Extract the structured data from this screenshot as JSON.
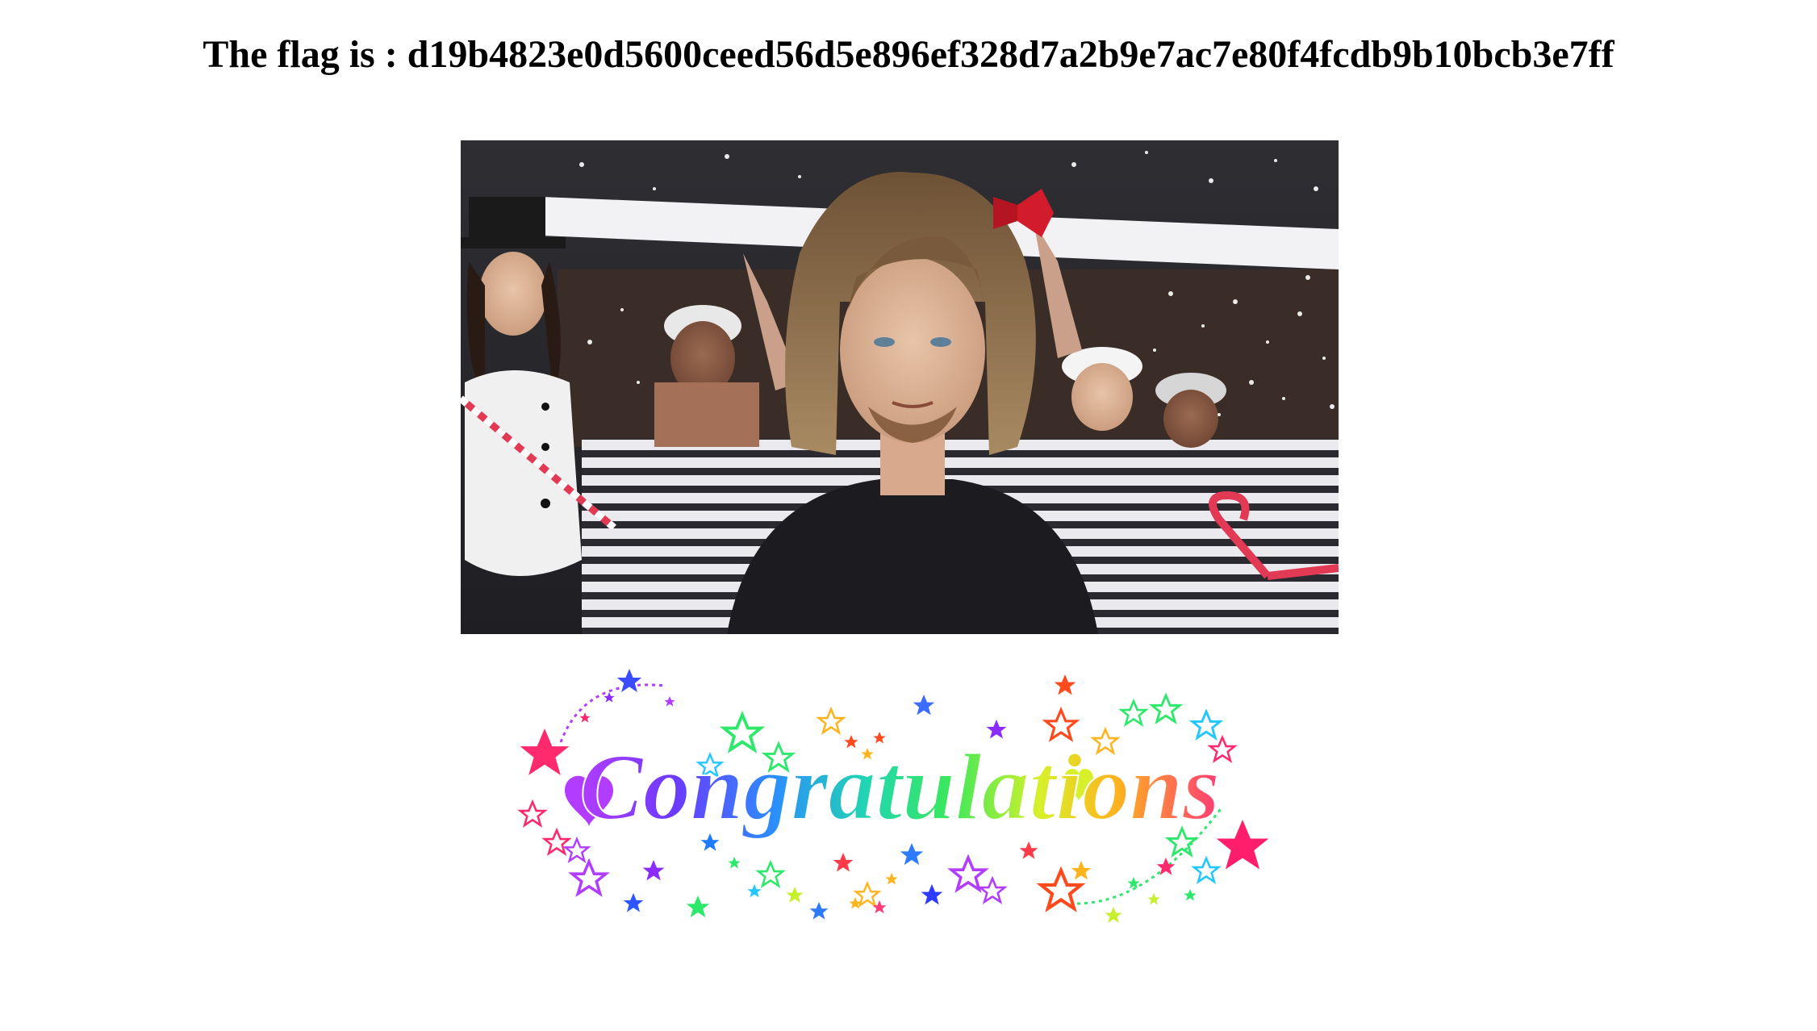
{
  "page": {
    "flag_prefix": "The flag is : ",
    "flag_value": "d19b4823e0d5600ceed56d5e896ef328d7a2b9e7ac7e80f4fcdb9b10bcb3e7ff"
  },
  "images": {
    "celebration_gif": {
      "icon": "celebration-photo"
    },
    "congratulations_banner": {
      "icon": "congratulations-star-banner",
      "text": "Congratulations"
    }
  },
  "colors": {
    "text": "#000000",
    "background": "#ffffff",
    "rainbow": [
      "#ff2a6d",
      "#b23cff",
      "#3b4cff",
      "#22c7ff",
      "#2ee86b",
      "#c6f02e",
      "#ffb41e",
      "#ff4a1e"
    ]
  }
}
